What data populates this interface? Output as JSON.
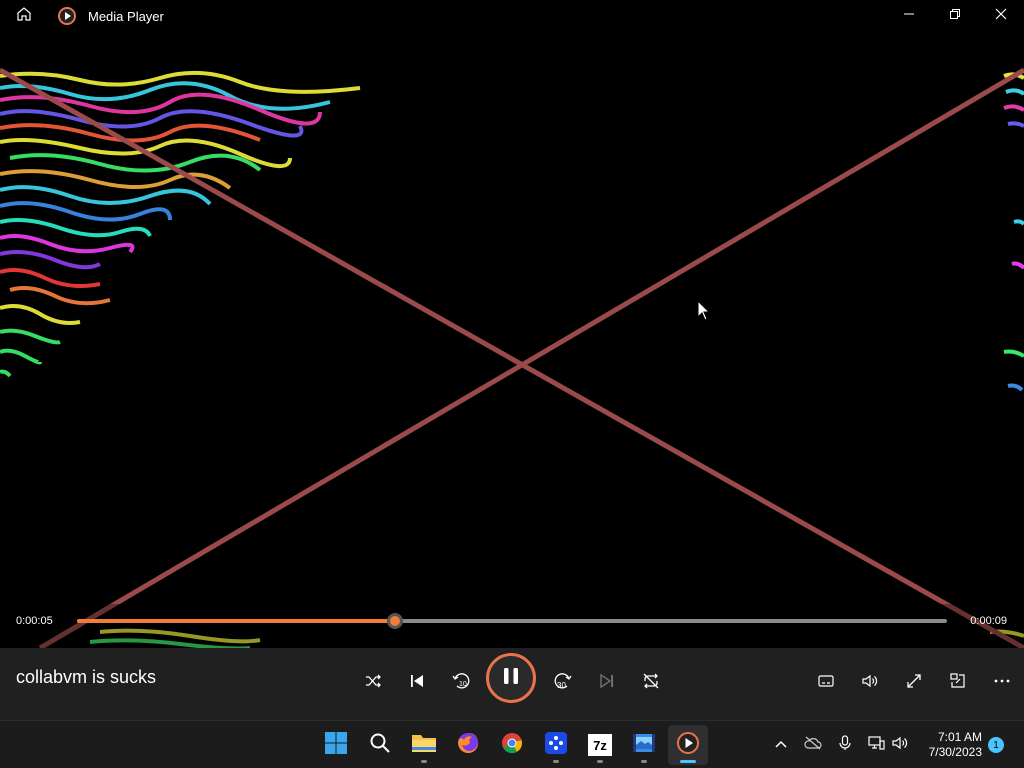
{
  "window": {
    "title": "Media Player"
  },
  "player": {
    "current_time": "0:00:05",
    "duration": "0:00:09",
    "progress": 0.366,
    "title": "collabvm is sucks"
  },
  "taskbar": {
    "items": [
      "start-icon",
      "search-icon",
      "file-explorer-icon",
      "firefox-icon",
      "chrome-icon",
      "app-icon",
      "7zip-icon",
      "video-editor-icon",
      "media-player-icon"
    ],
    "sevenzip_label": "7z",
    "time": "7:01 AM",
    "date": "7/30/2023",
    "notification_count": "1"
  },
  "colors": {
    "accent": "#f07d3b",
    "windows_blue": "#4cc2ff"
  }
}
